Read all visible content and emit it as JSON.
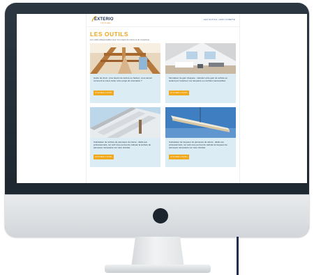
{
  "header": {
    "logo_text": "EXTERIO",
    "logo_subtext": "TOITURE",
    "nav_text": "LES OUTILS • MON COMPTE"
  },
  "page": {
    "title": "LES OUTILS",
    "subtitle": "Les outils indispensables pour vos projets de toiture et de couverture"
  },
  "cards": [
    {
      "text": "Guide de choix : plus besoin de lecture ou hésitez, vous saurez comment le mieux isoler votre projet de rénovation ?",
      "button_label": "UTILISER L'OUTIL"
    },
    {
      "text": "Simulateur de gain d'espace : calculez votre gain de surface en isolant par l'extérieur vos rampants ou combles inaccessibles",
      "button_label": "UTILISER L'OUTIL"
    },
    {
      "text": "Calculateur de surface de panneaux de toiture : dédié aux professionnels, cet outil vous permet de calculer la surface de panneaux nécessaire sur votre chantier",
      "button_label": "UTILISER L'OUTIL"
    },
    {
      "text": "Calculateur de longueur de panneaux de toiture : dédié aux professionnels, cet outil vous permet de calculer la longueur de panneaux nécessaire sur votre chantier",
      "button_label": "UTILISER L'OUTIL"
    }
  ],
  "colors": {
    "accent": "#f0a51a",
    "card_background": "#dcecf4",
    "brand_navy": "#1f2f4f",
    "monitor_frame": "#222d37"
  }
}
